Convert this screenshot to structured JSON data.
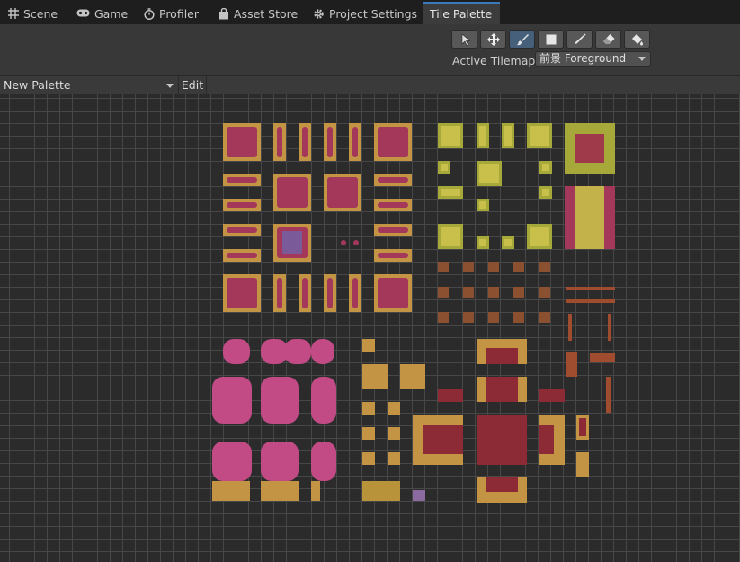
{
  "tabs": [
    {
      "label": "Scene",
      "icon": "grid-icon"
    },
    {
      "label": "Game",
      "icon": "gamepad-icon"
    },
    {
      "label": "Profiler",
      "icon": "stopwatch-icon"
    },
    {
      "label": "Asset Store",
      "icon": "shopping-bag-icon"
    },
    {
      "label": "Project Settings",
      "icon": "gear-icon"
    },
    {
      "label": "Tile Palette",
      "icon": "",
      "active": true
    }
  ],
  "tools": [
    {
      "name": "select-tool",
      "icon": "arrow-pointer-icon"
    },
    {
      "name": "move-tool",
      "icon": "move-arrows-icon"
    },
    {
      "name": "paint-tool",
      "icon": "paint-brush-icon",
      "selected": true
    },
    {
      "name": "box-fill-tool",
      "icon": "filled-box-icon"
    },
    {
      "name": "pick-tool",
      "icon": "eyedropper-icon"
    },
    {
      "name": "erase-tool",
      "icon": "eraser-icon"
    },
    {
      "name": "fill-tool",
      "icon": "paint-bucket-icon"
    }
  ],
  "active_tilemap": {
    "label": "Active Tilemap",
    "value": "前景 Foreground"
  },
  "palette": {
    "selected": "New Palette",
    "edit_label": "Edit"
  },
  "colors": {
    "tab_active_accent": "#3a79bb",
    "grid_line": "#474747",
    "canvas_bg": "#2b2b2b",
    "tile_sand": "#c49445",
    "tile_bush": "#a3385a",
    "tile_moss": "#a6a83a",
    "tile_path": "#8c2a36",
    "tile_tree": "#c24b86",
    "tile_wood": "#a04c2e"
  }
}
